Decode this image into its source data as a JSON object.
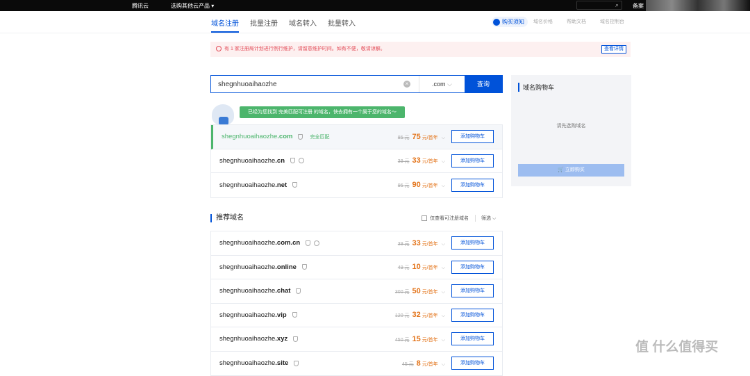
{
  "topbar": {
    "logo": "腾讯云",
    "products": "选购其他云产品 ▾",
    "search_icon": "search-icon",
    "user": "备案"
  },
  "nav": {
    "tabs": [
      "域名注册",
      "批量注册",
      "域名转入",
      "批量转入"
    ],
    "buy_notice": "购买须知",
    "links": [
      "域名价格",
      "帮助文档",
      "域名控制台"
    ]
  },
  "alert": {
    "text": "有 1 家注册局计划进行例行维护，请留意维护时间。如有不便，敬请谅解。",
    "detail": "查看详情"
  },
  "search": {
    "value": "shegnhuoaihaozhe",
    "suffix": ".com",
    "button": "查询"
  },
  "bubble": "已经为您找到 完美匹配可注册 的域名，快去拥有一个属于您的域名～",
  "results": [
    {
      "name": "shegnhuoaihaozhe",
      "tld": ".com",
      "tag": "完全匹配",
      "old": "85 元",
      "price": "75",
      "unit": "元/首年",
      "add": "添加购物车"
    },
    {
      "name": "shegnhuoaihaozhe",
      "tld": ".cn",
      "old": "39 元",
      "price": "33",
      "unit": "元/首年",
      "add": "添加购物车"
    },
    {
      "name": "shegnhuoaihaozhe",
      "tld": ".net",
      "old": "95 元",
      "price": "90",
      "unit": "元/首年",
      "add": "添加购物车"
    }
  ],
  "recommended": {
    "title": "推荐域名",
    "only_registrable": "仅查看可注册域名",
    "filter": "筛选 ⌵",
    "items": [
      {
        "name": "shegnhuoaihaozhe",
        "tld": ".com.cn",
        "old": "39 元",
        "price": "33",
        "unit": "元/首年",
        "add": "添加购物车"
      },
      {
        "name": "shegnhuoaihaozhe",
        "tld": ".online",
        "old": "49 元",
        "price": "10",
        "unit": "元/首年",
        "add": "添加购物车"
      },
      {
        "name": "shegnhuoaihaozhe",
        "tld": ".chat",
        "old": "300 元",
        "price": "50",
        "unit": "元/首年",
        "add": "添加购物车"
      },
      {
        "name": "shegnhuoaihaozhe",
        "tld": ".vip",
        "old": "120 元",
        "price": "32",
        "unit": "元/首年",
        "add": "添加购物车"
      },
      {
        "name": "shegnhuoaihaozhe",
        "tld": ".xyz",
        "old": "450 元",
        "price": "15",
        "unit": "元/首年",
        "add": "添加购物车"
      },
      {
        "name": "shegnhuoaihaozhe",
        "tld": ".site",
        "old": "45 元",
        "price": "8",
        "unit": "元/首年",
        "add": "添加购物车"
      }
    ]
  },
  "cart": {
    "title": "域名购物车",
    "empty": "请先选购域名",
    "buy": "🛒 立即购买"
  },
  "watermark": "值 什么值得买"
}
